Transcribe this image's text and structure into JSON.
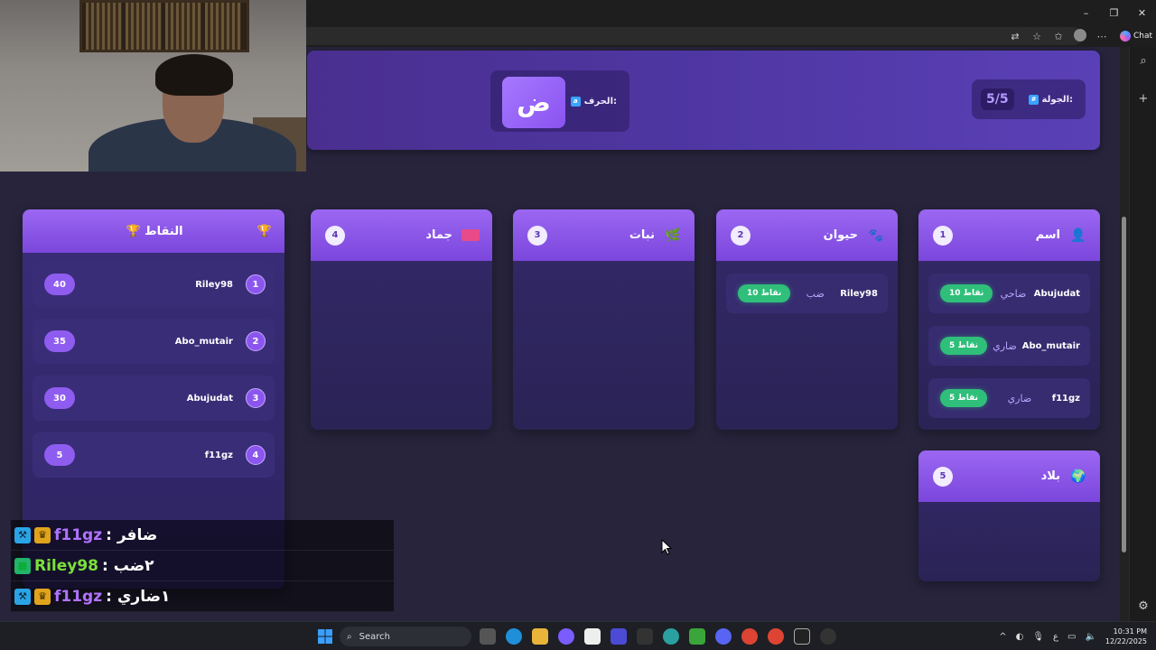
{
  "browser": {
    "window_controls": [
      "–",
      "❐",
      "✕"
    ],
    "chat_label": "Chat",
    "address_icons": [
      "translate-icon",
      "star-icon",
      "favorites-icon",
      "profile-icon",
      "more-icon"
    ]
  },
  "game": {
    "round_label": "الجولة:",
    "round_value": "5/5",
    "letter_label": "الحرف:",
    "letter": "ض",
    "categories": [
      {
        "name": "اسم",
        "count": "1",
        "answers": [
          {
            "player": "Abujudat",
            "word": "ضاحي",
            "points": "10 نقاط"
          },
          {
            "player": "Abo_mutair",
            "word": "ضاري",
            "points": "5 نقاط"
          },
          {
            "player": "f11gz",
            "word": "ضاري",
            "points": "5 نقاط"
          }
        ]
      },
      {
        "name": "حيوان",
        "count": "2",
        "answers": [
          {
            "player": "Riley98",
            "word": "ضب",
            "points": "10 نقاط"
          }
        ]
      },
      {
        "name": "نبات",
        "count": "3",
        "answers": []
      },
      {
        "name": "جماد",
        "count": "4",
        "answers": []
      },
      {
        "name": "بلاد",
        "count": "5",
        "answers": []
      }
    ],
    "leaderboard": {
      "title": "🏆 النقاط",
      "rows": [
        {
          "rank": "1",
          "player": "Riley98",
          "score": "40"
        },
        {
          "rank": "2",
          "player": "Abo_mutair",
          "score": "35"
        },
        {
          "rank": "3",
          "player": "Abujudat",
          "score": "30"
        },
        {
          "rank": "4",
          "player": "f11gz",
          "score": "5"
        }
      ]
    }
  },
  "chat_overlay": [
    {
      "user": "f11gz",
      "message": ": ضافر"
    },
    {
      "user": "Riley98",
      "message": ": ٢ضب"
    },
    {
      "user": "f11gz",
      "message": ": ١ضاري"
    }
  ],
  "taskbar": {
    "search_label": "Search",
    "time": "10:31 PM",
    "date": "12/22/2025",
    "lang": "ع"
  }
}
